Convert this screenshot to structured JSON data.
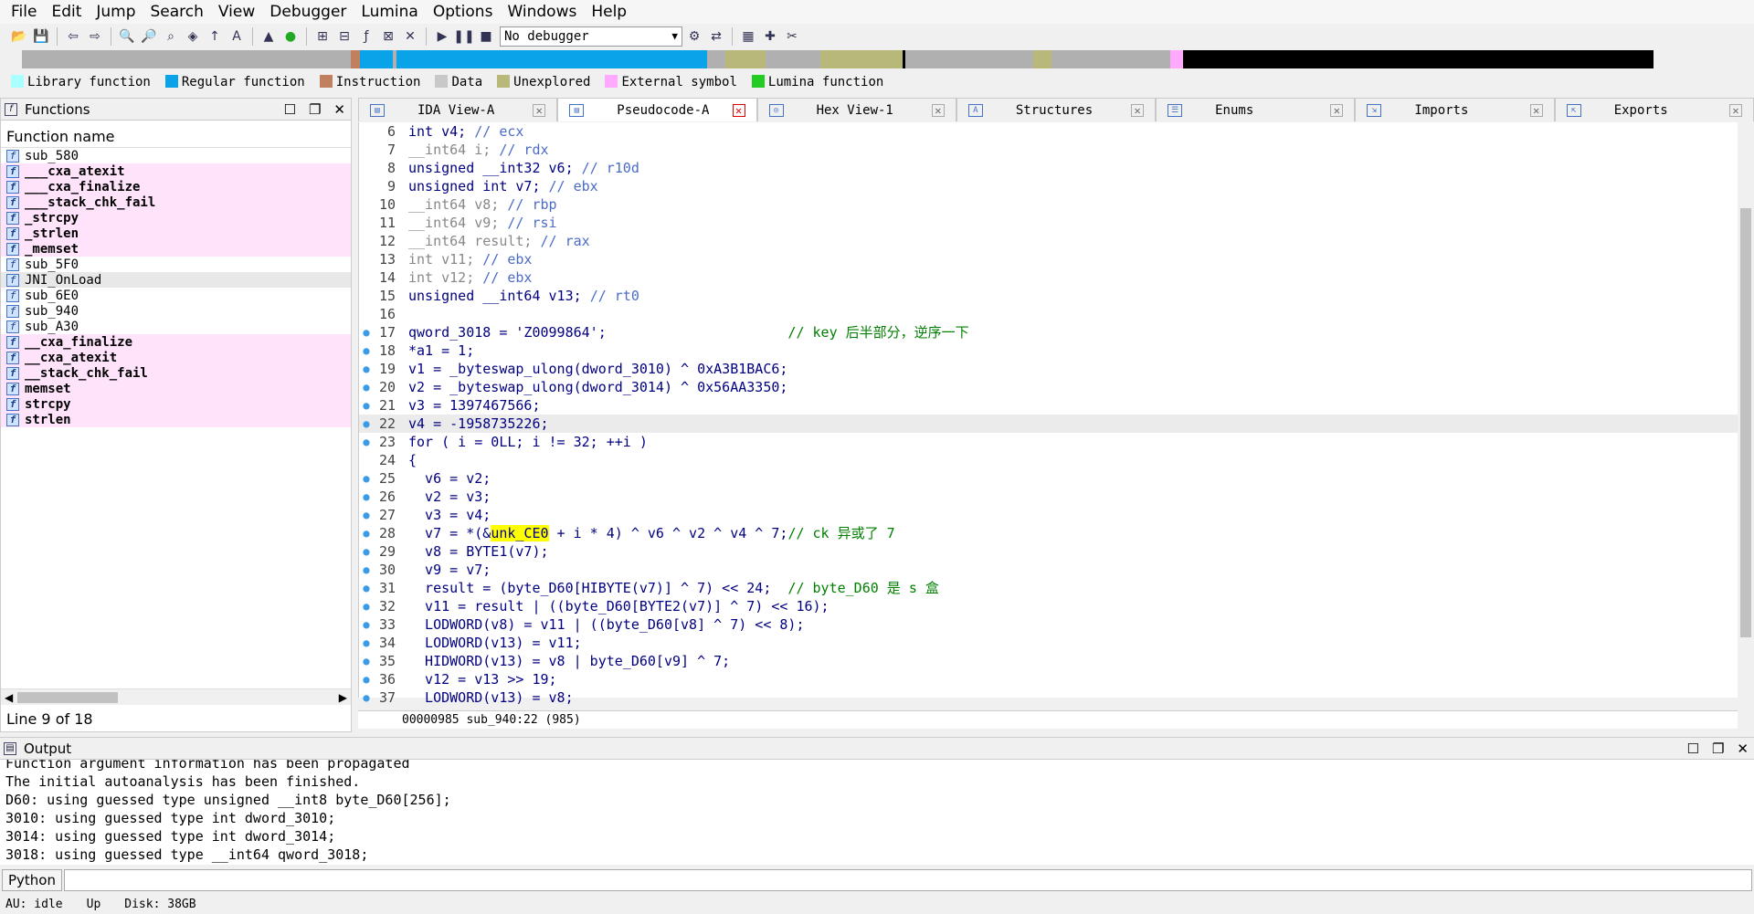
{
  "menu": [
    "File",
    "Edit",
    "Jump",
    "Search",
    "View",
    "Debugger",
    "Lumina",
    "Options",
    "Windows",
    "Help"
  ],
  "toolbar": {
    "debugger_select": "No debugger"
  },
  "legend": [
    {
      "label": "Library function",
      "color": "#aaffff"
    },
    {
      "label": "Regular function",
      "color": "#0aa2e8"
    },
    {
      "label": "Instruction",
      "color": "#c08060"
    },
    {
      "label": "Data",
      "color": "#c8c8c8"
    },
    {
      "label": "Unexplored",
      "color": "#b8b87a"
    },
    {
      "label": "External symbol",
      "color": "#ffaaff"
    },
    {
      "label": "Lumina function",
      "color": "#22cc22"
    }
  ],
  "functions": {
    "title": "Functions",
    "column": "Function name",
    "items": [
      "sub_580",
      "___cxa_atexit",
      "___cxa_finalize",
      "___stack_chk_fail",
      "_strcpy",
      "_strlen",
      "_memset",
      "sub_5F0",
      "JNI_OnLoad",
      "sub_6E0",
      "sub_940",
      "sub_A30",
      "__cxa_finalize",
      "__cxa_atexit",
      "__stack_chk_fail",
      "memset",
      "strcpy",
      "strlen"
    ],
    "status": "Line 9 of 18"
  },
  "tabs": [
    "IDA View-A",
    "Pseudocode-A",
    "Hex View-1",
    "Structures",
    "Enums",
    "Imports",
    "Exports"
  ],
  "code": {
    "lines": [
      {
        "n": "6",
        "t": "int v4; // ecx"
      },
      {
        "n": "7",
        "t": "__int64 i; // rdx"
      },
      {
        "n": "8",
        "t": "unsigned __int32 v6; // r10d"
      },
      {
        "n": "9",
        "t": "unsigned int v7; // ebx"
      },
      {
        "n": "10",
        "t": "__int64 v8; // rbp"
      },
      {
        "n": "11",
        "t": "__int64 v9; // rsi"
      },
      {
        "n": "12",
        "t": "__int64 result; // rax"
      },
      {
        "n": "13",
        "t": "int v11; // ebx"
      },
      {
        "n": "14",
        "t": "int v12; // ebx"
      },
      {
        "n": "15",
        "t": "unsigned __int64 v13; // rt0"
      },
      {
        "n": "16",
        "t": ""
      },
      {
        "n": "17",
        "t": "qword_3018 = 'Z0099864';                      // key 后半部分，逆序一下"
      },
      {
        "n": "18",
        "t": "*a1 = 1;"
      },
      {
        "n": "19",
        "t": "v1 = _byteswap_ulong(dword_3010) ^ 0xA3B1BAC6;"
      },
      {
        "n": "20",
        "t": "v2 = _byteswap_ulong(dword_3014) ^ 0x56AA3350;"
      },
      {
        "n": "21",
        "t": "v3 = 1397467566;"
      },
      {
        "n": "22",
        "t": "v4 = -1958735226;"
      },
      {
        "n": "23",
        "t": "for ( i = 0LL; i != 32; ++i )"
      },
      {
        "n": "24",
        "t": "{"
      },
      {
        "n": "25",
        "t": "  v6 = v2;"
      },
      {
        "n": "26",
        "t": "  v2 = v3;"
      },
      {
        "n": "27",
        "t": "  v3 = v4;"
      },
      {
        "n": "28",
        "t": "  v7 = *(&unk_CE0 + i * 4) ^ v6 ^ v2 ^ v4 ^ 7;// ck 异或了 7"
      },
      {
        "n": "29",
        "t": "  v8 = BYTE1(v7);"
      },
      {
        "n": "30",
        "t": "  v9 = v7;"
      },
      {
        "n": "31",
        "t": "  result = (byte_D60[HIBYTE(v7)] ^ 7) << 24;  // byte_D60 是 s 盒"
      },
      {
        "n": "32",
        "t": "  v11 = result | ((byte_D60[BYTE2(v7)] ^ 7) << 16);"
      },
      {
        "n": "33",
        "t": "  LODWORD(v8) = v11 | ((byte_D60[v8] ^ 7) << 8);"
      },
      {
        "n": "34",
        "t": "  LODWORD(v13) = v11;"
      },
      {
        "n": "35",
        "t": "  HIDWORD(v13) = v8 | byte_D60[v9] ^ 7;"
      },
      {
        "n": "36",
        "t": "  v12 = v13 >> 19;"
      },
      {
        "n": "37",
        "t": "  LODWORD(v13) = v8;"
      }
    ],
    "footer": "00000985 sub_940:22 (985)"
  },
  "output": {
    "title": "Output",
    "lines": [
      "Function argument information has been propagated",
      "The initial autoanalysis has been finished.",
      "D60: using guessed type unsigned __int8 byte_D60[256];",
      "3010: using guessed type int dword_3010;",
      "3014: using guessed type int dword_3014;",
      "3018: using guessed type __int64 qword_3018;"
    ]
  },
  "python_label": "Python",
  "statusbar": [
    "AU:  idle",
    "Up",
    "Disk: 38GB"
  ]
}
